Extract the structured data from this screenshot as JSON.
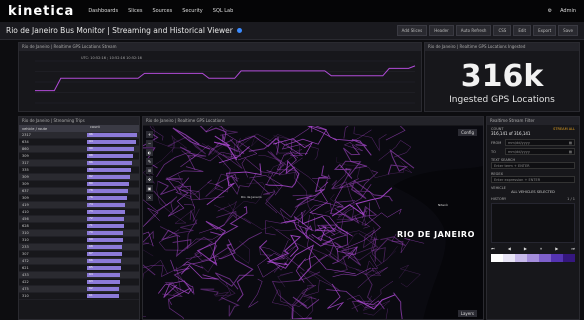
{
  "nav": {
    "logo": "kinetica",
    "items": [
      "Dashboards",
      "Slices",
      "Sources",
      "Security",
      "SQL Lab"
    ],
    "right_items": [
      "Admin"
    ]
  },
  "header": {
    "title": "Rio de Janeiro Bus Monitor | Streaming and Historical Viewer",
    "buttons": [
      "Add Slices",
      "Header",
      "Auto Refresh",
      "CSS",
      "Edit",
      "Export",
      "Save"
    ]
  },
  "panels": {
    "line_title": "Rio de Janeiro | Realtime GPS Locations Stream",
    "kpi_title": "Rio de Janeiro | Realtime GPS Locations Ingested",
    "table_title": "Rio de Janeiro | Streaming Trips",
    "map_title": "Rio de Janeiro | Realtime GPS Locations",
    "filter_title": "Realtime Stream Filter"
  },
  "kpi": {
    "value": "316k",
    "label": "Ingested GPS Locations"
  },
  "line_chart": {
    "chart_data": {
      "type": "line",
      "x": [
        0,
        1,
        2,
        3,
        4,
        5,
        6,
        7,
        8,
        9,
        10,
        11,
        12,
        13,
        14,
        15,
        16,
        17,
        18,
        19,
        20,
        21,
        22,
        23,
        24,
        25,
        26,
        27,
        28,
        29,
        30,
        31,
        32,
        33,
        34,
        35,
        36,
        37,
        38,
        39,
        40,
        41,
        42,
        43,
        44,
        45,
        46,
        47,
        48,
        49,
        50,
        51,
        52,
        53,
        54,
        55,
        56,
        57,
        58,
        59
      ],
      "values": [
        300,
        300,
        300,
        300,
        305,
        305,
        305,
        305,
        305,
        305,
        305,
        305,
        305,
        305,
        305,
        305,
        305,
        307,
        307,
        307,
        307,
        307,
        307,
        307,
        307,
        307,
        307,
        305,
        305,
        305,
        305,
        305,
        308,
        308,
        308,
        308,
        308,
        308,
        308,
        308,
        308,
        308,
        308,
        308,
        308,
        308,
        306,
        306,
        306,
        306,
        306,
        306,
        306,
        306,
        306,
        309,
        309,
        309,
        309,
        310
      ],
      "ylim": [
        295,
        312
      ],
      "ylabel": "",
      "xlabel": "",
      "legend": "top-left",
      "series_name": "",
      "color": "#b14bd8"
    },
    "tooltip": "UTC: 10:52:16 ; 10:52:16 10:52:16"
  },
  "table": {
    "headers": [
      "vehicle / route",
      "count"
    ],
    "rows": [
      {
        "id": "2317",
        "count": 96
      },
      {
        "id": "634",
        "count": 94
      },
      {
        "id": "860",
        "count": 90
      },
      {
        "id": "309",
        "count": 88
      },
      {
        "id": "317",
        "count": 86
      },
      {
        "id": "335",
        "count": 84
      },
      {
        "id": "309",
        "count": 82
      },
      {
        "id": "309",
        "count": 80
      },
      {
        "id": "637",
        "count": 78
      },
      {
        "id": "309",
        "count": 76
      },
      {
        "id": "419",
        "count": 74
      },
      {
        "id": "410",
        "count": 73
      },
      {
        "id": "456",
        "count": 72
      },
      {
        "id": "628",
        "count": 71
      },
      {
        "id": "310",
        "count": 70
      },
      {
        "id": "310",
        "count": 69
      },
      {
        "id": "233",
        "count": 68
      },
      {
        "id": "307",
        "count": 67
      },
      {
        "id": "472",
        "count": 66
      },
      {
        "id": "621",
        "count": 65
      },
      {
        "id": "433",
        "count": 64
      },
      {
        "id": "422",
        "count": 63
      },
      {
        "id": "475",
        "count": 62
      },
      {
        "id": "310",
        "count": 61
      }
    ],
    "max": 100,
    "bar_color": "#8c7ad8"
  },
  "map": {
    "city_label": "RIO DE JANEIRO",
    "small_labels": [
      "Rio de Janeiro",
      "Niterói"
    ],
    "buttons": [
      "Config",
      "Layers"
    ],
    "line_color": "#b14bd8",
    "bg_color": "#0a0a10"
  },
  "filter": {
    "status": "STREAM ALL",
    "count_label": "COUNT",
    "count_value": "316,141 of 316,141",
    "from_label": "FROM",
    "from_value": "mm/dd/yyyy",
    "to_label": "TO",
    "to_value": "mm/dd/yyyy",
    "search_label": "TEXT SEARCH",
    "search_placeholder": "Enter term + ENTER",
    "regex_label": "REGEX",
    "regex_placeholder": "Enter expression + ENTER",
    "vehicle_label": "VEHICLE",
    "vehicle_all": "ALL VEHICLES SELECTED",
    "history_label": "HISTORY",
    "history_count": "1 / 1",
    "legend_colors": [
      "#ffffff",
      "#e8e4f5",
      "#c7b9ea",
      "#a48ddc",
      "#7e60cb",
      "#5534b3",
      "#35177f"
    ]
  }
}
